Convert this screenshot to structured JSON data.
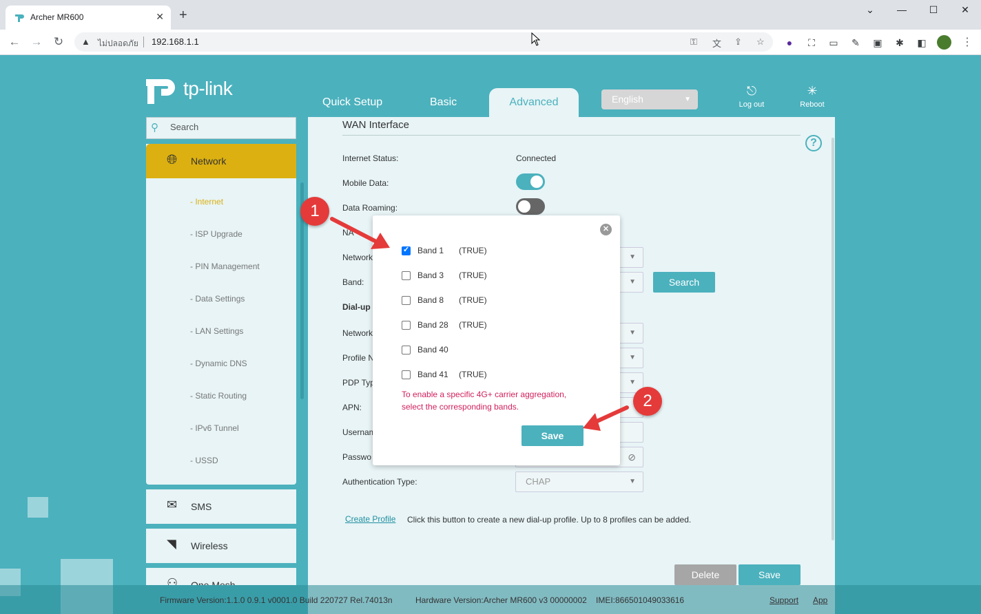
{
  "browser": {
    "tab_title": "Archer MR600",
    "tab_close": "✕",
    "new_tab": "+",
    "window_controls": {
      "minimize": "—",
      "maximize": "☐",
      "close": "✕"
    },
    "security_label": "ไม่ปลอดภัย",
    "url": "192.168.1.1"
  },
  "brand": {
    "logo_text": "tp-link",
    "accent": "#4bb1bd",
    "highlight": "#dcb011"
  },
  "topnav": {
    "items": [
      "Quick Setup",
      "Basic",
      "Advanced"
    ],
    "active": "Advanced",
    "language": "English",
    "logout_label": "Log out",
    "reboot_label": "Reboot"
  },
  "sidebar": {
    "search_placeholder": "Search",
    "network_label": "Network",
    "network_items": [
      "- Internet",
      "- ISP Upgrade",
      "- PIN Management",
      "- Data Settings",
      "- LAN Settings",
      "- Dynamic DNS",
      "- Static Routing",
      "- IPv6 Tunnel",
      "- USSD"
    ],
    "active_item": "- Internet",
    "sms_label": "SMS",
    "wireless_label": "Wireless",
    "onemesh_label": "One Mesh"
  },
  "main": {
    "title": "WAN Interface",
    "help": "?",
    "internet_status_label": "Internet Status:",
    "internet_status_value": "Connected",
    "mobile_data_label": "Mobile Data:",
    "data_roaming_label": "Data Roaming:",
    "nat_label": "NA",
    "network_label_1": "Network",
    "band_label": "Band:",
    "search_button": "Search",
    "dialup_label": "Dial-up",
    "network_label_2": "Network",
    "profile_label": "Profile N",
    "pdp_label": "PDP Typ",
    "apn_label": "APN:",
    "username_label": "Usernam",
    "password_label": "Passwo",
    "auth_label": "Authentication Type:",
    "auth_value": "CHAP",
    "create_profile_link": "Create Profile",
    "create_profile_note": "Click this button to create a new dial-up profile. Up to 8 profiles can be added.",
    "delete_button": "Delete",
    "save_button": "Save"
  },
  "modal": {
    "close": "✕",
    "bands": [
      {
        "name": "Band 1",
        "status": "(TRUE)",
        "checked": true
      },
      {
        "name": "Band 3",
        "status": "(TRUE)",
        "checked": false
      },
      {
        "name": "Band 8",
        "status": "(TRUE)",
        "checked": false
      },
      {
        "name": "Band 28",
        "status": "(TRUE)",
        "checked": false
      },
      {
        "name": "Band 40",
        "status": "",
        "checked": false
      },
      {
        "name": "Band 41",
        "status": "(TRUE)",
        "checked": false
      }
    ],
    "note": "To enable a specific 4G+ carrier aggregation, select the corresponding bands.",
    "save_button": "Save"
  },
  "annotations": {
    "badge_1": "1",
    "badge_2": "2",
    "color": "#e53a3a"
  },
  "footer": {
    "firmware": "Firmware Version:1.1.0 0.9.1 v0001.0 Build 220727 Rel.74013n",
    "hardware": "Hardware Version:Archer MR600 v3 00000002",
    "imei": "IMEI:866501049033616",
    "support": "Support",
    "app": "App"
  }
}
